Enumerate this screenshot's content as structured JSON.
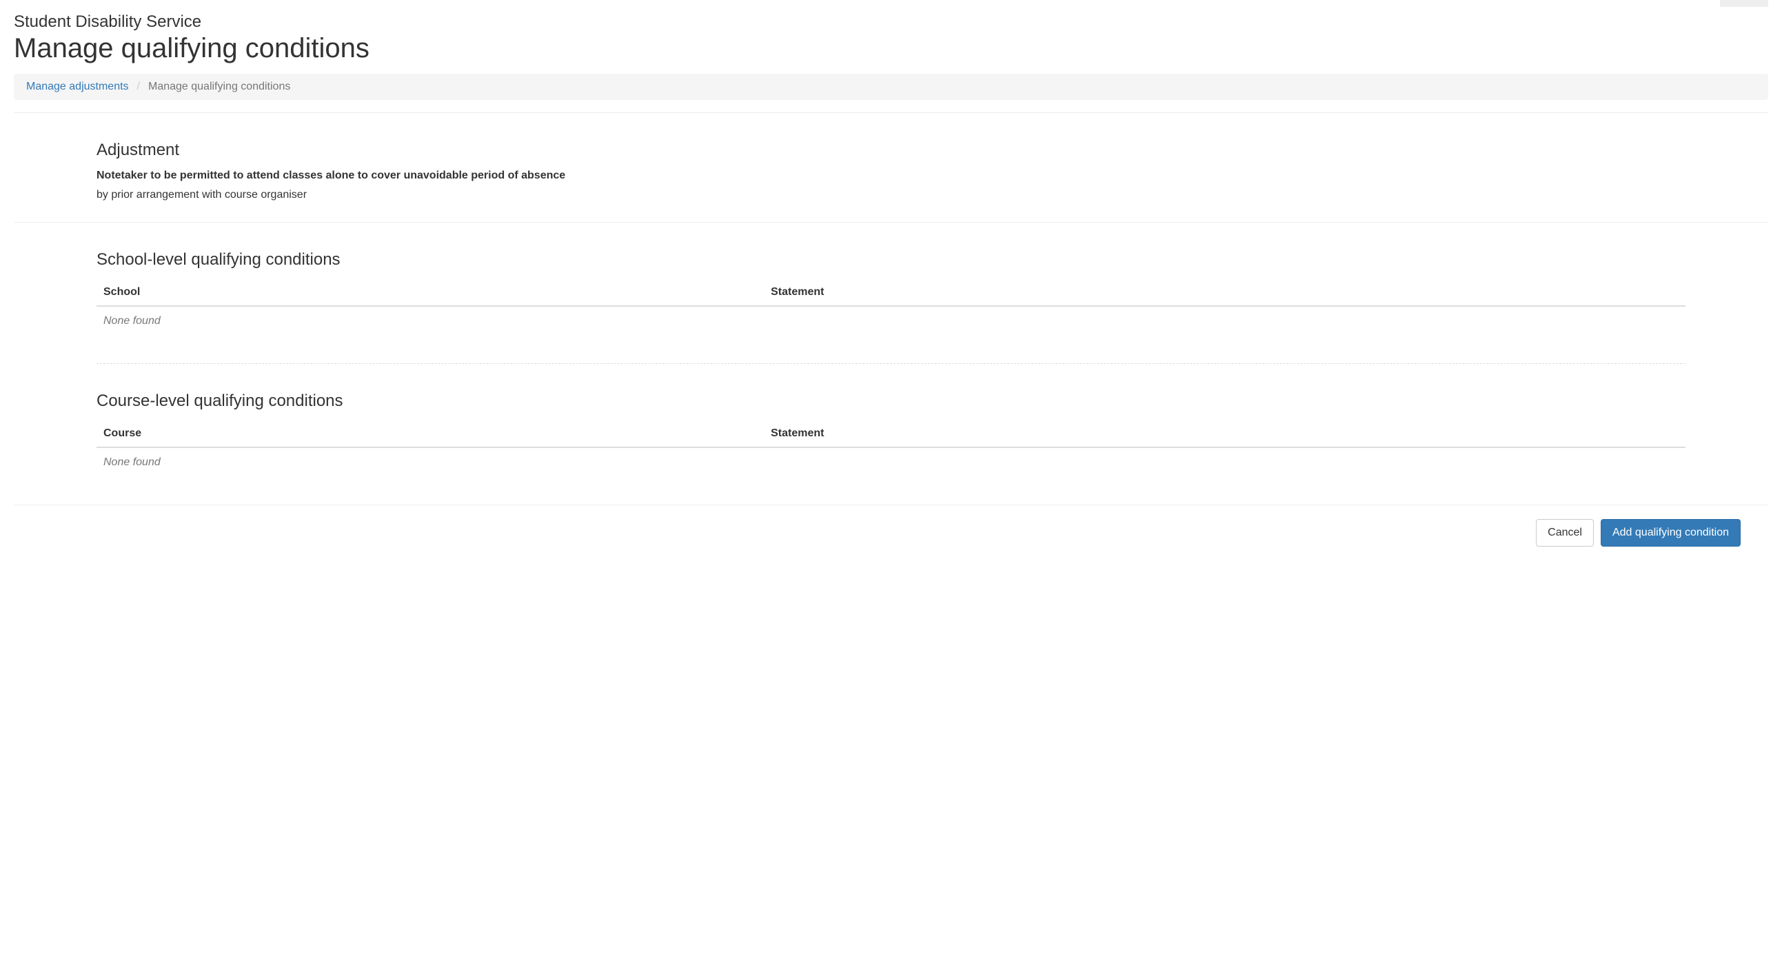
{
  "header": {
    "service_name": "Student Disability Service",
    "page_title": "Manage qualifying conditions"
  },
  "breadcrumb": {
    "parent_label": "Manage adjustments",
    "current_label": "Manage qualifying conditions"
  },
  "adjustment": {
    "section_heading": "Adjustment",
    "title": "Notetaker to be permitted to attend classes alone to cover unavoidable period of absence",
    "note": "by prior arrangement with course organiser"
  },
  "school_conditions": {
    "section_heading": "School-level qualifying conditions",
    "columns": {
      "col1": "School",
      "col2": "Statement"
    },
    "empty_text": "None found"
  },
  "course_conditions": {
    "section_heading": "Course-level qualifying conditions",
    "columns": {
      "col1": "Course",
      "col2": "Statement"
    },
    "empty_text": "None found"
  },
  "footer": {
    "cancel_label": "Cancel",
    "add_label": "Add qualifying condition"
  }
}
